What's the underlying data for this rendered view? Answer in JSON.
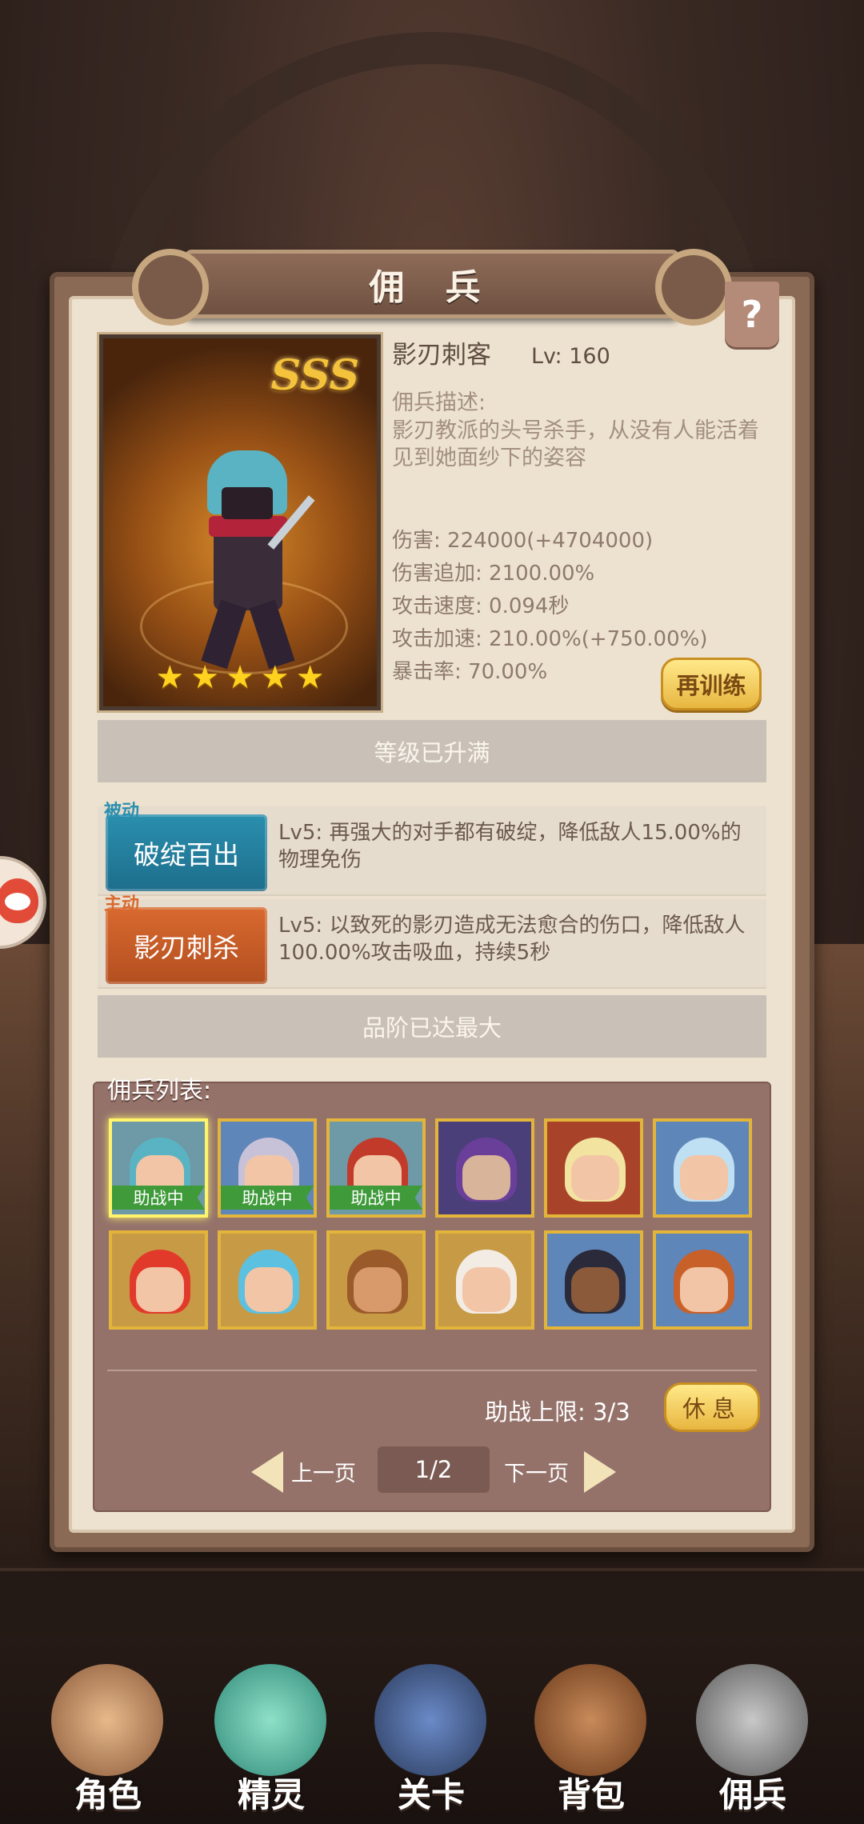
{
  "title": "佣 兵",
  "help_label": "?",
  "hero": {
    "name": "影刃刺客",
    "level_label": "Lv:  160",
    "grade": "SSS",
    "star_count": 5,
    "desc_label": "佣兵描述:",
    "desc_text": "影刃教派的头号杀手，从没有人能活着见到她面纱下的姿容"
  },
  "stats": [
    "伤害: 224000(+4704000)",
    "伤害追加: 2100.00%",
    "攻击速度: 0.094秒",
    "攻击加速: 210.00%(+750.00%)",
    "暴击率: 70.00%"
  ],
  "retrain_label": "再训练",
  "level_max_label": "等级已升满",
  "skills": [
    {
      "tag": "被动",
      "name": "破绽百出",
      "desc": "Lv5:  再强大的对手都有破绽，降低敌人15.00%的物理免伤"
    },
    {
      "tag": "主动",
      "name": "影刃刺杀",
      "desc": "Lv5:  以致死的影刃造成无法愈合的伤口，降低敌人100.00%攻击吸血，持续5秒"
    }
  ],
  "rank_max_label": "品阶已达最大",
  "roster": {
    "label": "佣兵列表:",
    "helping_label": "助战中",
    "limit_text": "助战上限: 3/3",
    "rest_label": "休息",
    "prev_label": "上一页",
    "next_label": "下一页",
    "page": "1/2"
  },
  "nav": [
    "角色",
    "精灵",
    "关卡",
    "背包",
    "佣兵"
  ]
}
